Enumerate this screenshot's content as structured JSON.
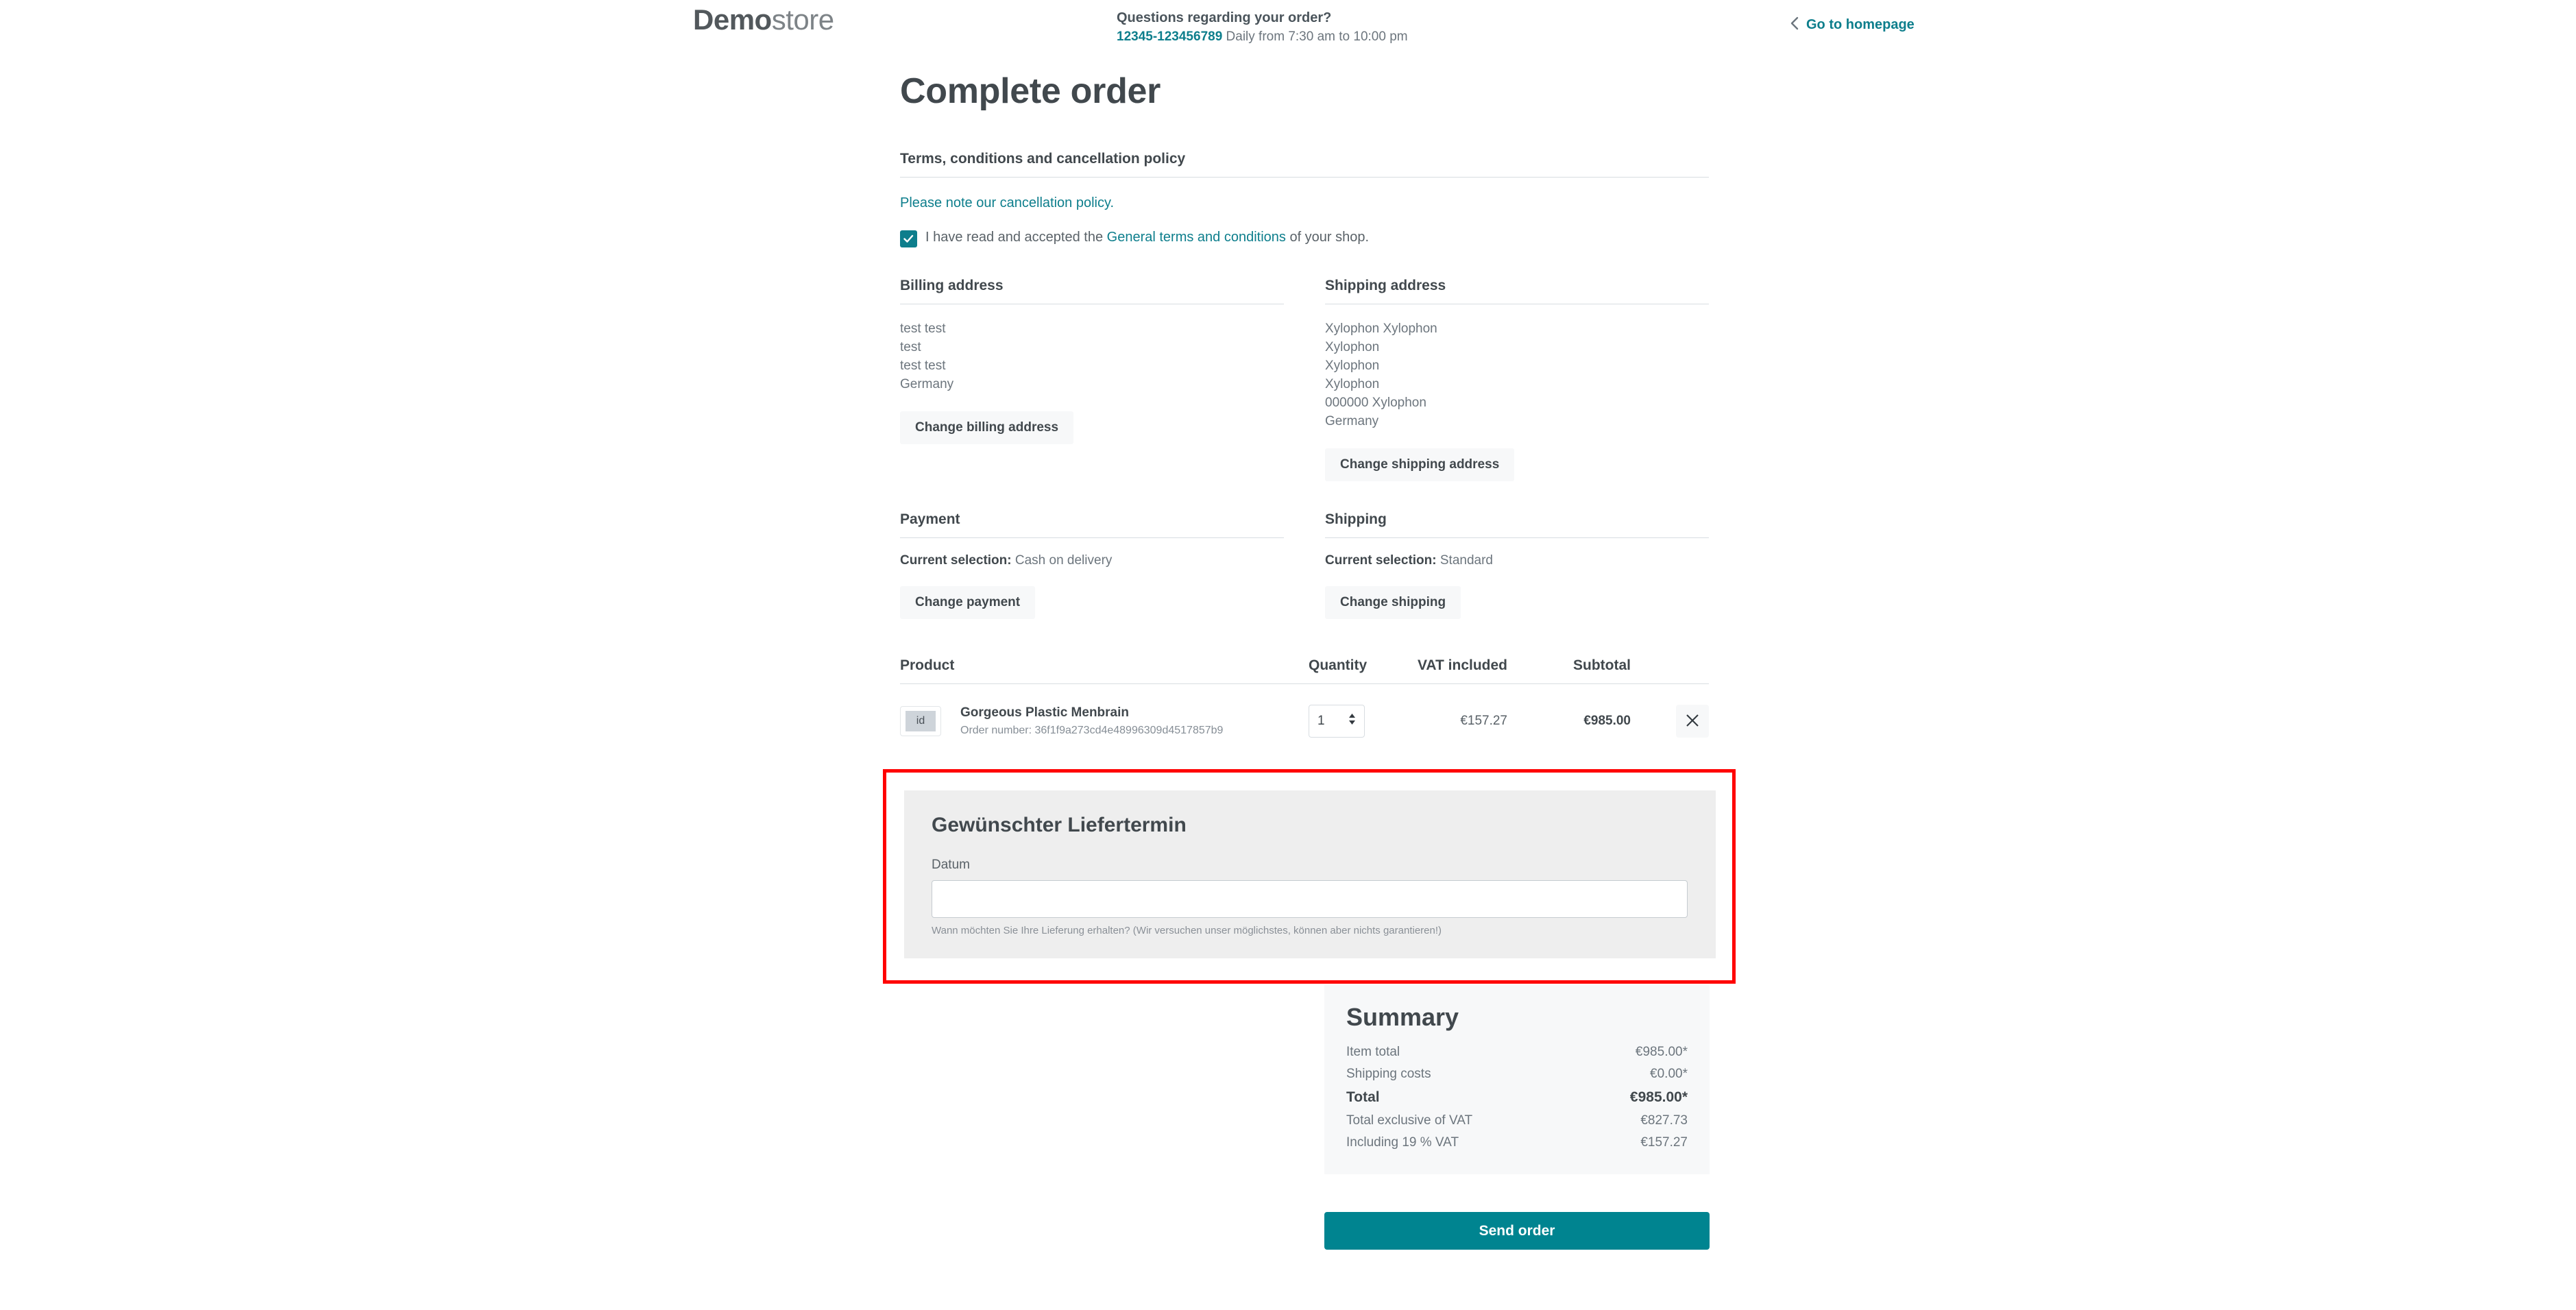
{
  "header": {
    "logo_bold": "Demo",
    "logo_light": "store",
    "contact_title": "Questions regarding your order?",
    "phone": "12345-123456789",
    "hours": "Daily from 7:30 am to 10:00 pm",
    "homepage_label": "Go to homepage",
    "back_icon": "chevron-left-icon"
  },
  "page_title": "Complete order",
  "terms": {
    "heading": "Terms, conditions and cancellation policy",
    "cancellation_link": "Please note our cancellation policy.",
    "accept_prefix": "I have read and accepted the ",
    "accept_link": "General terms and conditions",
    "accept_suffix": " of your shop.",
    "checked": true
  },
  "billing": {
    "heading": "Billing address",
    "lines": [
      "test test",
      "test",
      "test test",
      "Germany"
    ],
    "change_button": "Change billing address"
  },
  "shipping_address": {
    "heading": "Shipping address",
    "lines": [
      "Xylophon Xylophon",
      "Xylophon",
      "Xylophon",
      "Xylophon",
      "000000 Xylophon",
      "Germany"
    ],
    "change_button": "Change shipping address"
  },
  "payment": {
    "heading": "Payment",
    "current_label": "Current selection:",
    "current_value": "Cash on delivery",
    "change_button": "Change payment"
  },
  "shipping_method": {
    "heading": "Shipping",
    "current_label": "Current selection:",
    "current_value": "Standard",
    "change_button": "Change shipping"
  },
  "cart": {
    "columns": {
      "product": "Product",
      "quantity": "Quantity",
      "vat": "VAT included",
      "subtotal": "Subtotal"
    },
    "items": [
      {
        "thumb_text": "id",
        "name": "Gorgeous Plastic Menbrain",
        "order_number_label": "Order number: 36f1f9a273cd4e48996309d4517857b9",
        "quantity": "1",
        "vat": "€157.27",
        "subtotal": "€985.00",
        "remove_icon": "close-icon"
      }
    ]
  },
  "custom_field": {
    "title": "Gewünschter Liefertermin",
    "label": "Datum",
    "value": "",
    "placeholder": "",
    "help": "Wann möchten Sie Ihre Lieferung erhalten? (Wir versuchen unser möglichstes, können aber nichts garantieren!)"
  },
  "summary": {
    "title": "Summary",
    "rows": [
      {
        "label": "Item total",
        "value": "€985.00*",
        "strong": false
      },
      {
        "label": "Shipping costs",
        "value": "€0.00*",
        "strong": false
      },
      {
        "label": "Total",
        "value": "€985.00*",
        "strong": true
      },
      {
        "label": "Total exclusive of VAT",
        "value": "€827.73",
        "strong": false
      },
      {
        "label": "Including 19 % VAT",
        "value": "€157.27",
        "strong": false
      }
    ],
    "send_button": "Send order"
  },
  "colors": {
    "accent": "#0d7e8c",
    "button": "#008490",
    "highlight": "#ff0000",
    "text": "#41484d",
    "muted": "#6c757d"
  }
}
